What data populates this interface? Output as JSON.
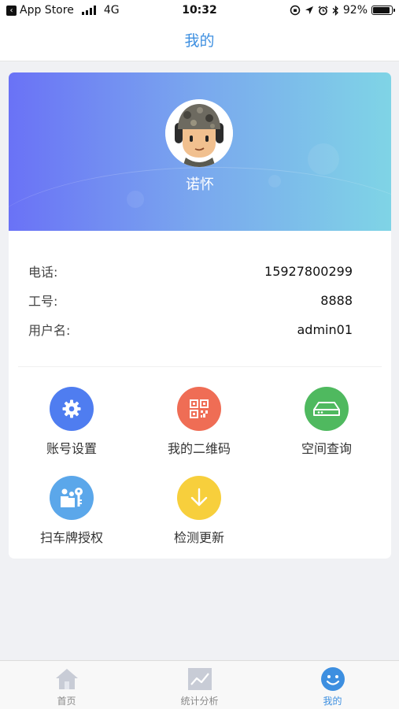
{
  "status_bar": {
    "back_app": "App Store",
    "network": "4G",
    "time": "10:32",
    "battery_text": "92%",
    "battery_level": 0.92
  },
  "nav": {
    "title": "我的"
  },
  "profile": {
    "name": "诺怀",
    "avatar_icon": "soldier-avatar"
  },
  "info": [
    {
      "label": "电话:",
      "value": "15927800299"
    },
    {
      "label": "工号:",
      "value": "8888"
    },
    {
      "label": "用户名:",
      "value": "admin01"
    }
  ],
  "menu": [
    {
      "label": "账号设置",
      "icon": "gear-icon",
      "color": "#4f7df0"
    },
    {
      "label": "我的二维码",
      "icon": "qr-code-icon",
      "color": "#ef6d55"
    },
    {
      "label": "空间查询",
      "icon": "storage-icon",
      "color": "#4fb95f"
    },
    {
      "label": "扫车牌授权",
      "icon": "people-key-icon",
      "color": "#5ba7ea"
    },
    {
      "label": "检测更新",
      "icon": "download-arrow-icon",
      "color": "#f7cf3c"
    }
  ],
  "tabs": [
    {
      "label": "首页",
      "icon": "home-icon",
      "active": false
    },
    {
      "label": "统计分析",
      "icon": "chart-icon",
      "active": false
    },
    {
      "label": "我的",
      "icon": "smiley-icon",
      "active": true
    }
  ],
  "colors": {
    "accent": "#3d8fe0",
    "banner_start": "#6a72f6",
    "banner_end": "#7fd4e6"
  }
}
